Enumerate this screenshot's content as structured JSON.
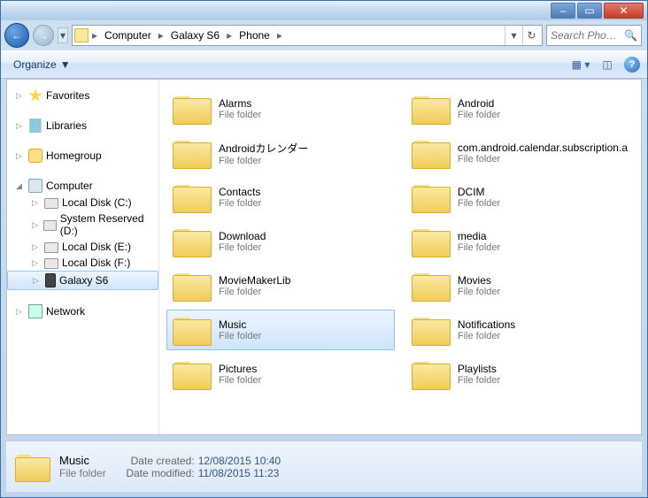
{
  "window_controls": {
    "min": "–",
    "max": "▭",
    "close": "✕"
  },
  "breadcrumb": [
    "Computer",
    "Galaxy S6",
    "Phone"
  ],
  "search_placeholder": "Search Pho…",
  "toolbar": {
    "organize": "Organize"
  },
  "nav": {
    "favorites": "Favorites",
    "libraries": "Libraries",
    "homegroup": "Homegroup",
    "computer": "Computer",
    "drives": [
      "Local Disk (C:)",
      "System Reserved (D:)",
      "Local Disk (E:)",
      "Local Disk (F:)",
      "Galaxy S6"
    ],
    "network": "Network"
  },
  "item_type_label": "File folder",
  "items": [
    {
      "name": "Alarms"
    },
    {
      "name": "Android"
    },
    {
      "name": "Androidカレンダー"
    },
    {
      "name": "com.android.calendar.subscription.a"
    },
    {
      "name": "Contacts"
    },
    {
      "name": "DCIM"
    },
    {
      "name": "Download"
    },
    {
      "name": "media"
    },
    {
      "name": "MovieMakerLib"
    },
    {
      "name": "Movies"
    },
    {
      "name": "Music",
      "selected": true
    },
    {
      "name": "Notifications"
    },
    {
      "name": "Pictures"
    },
    {
      "name": "Playlists"
    }
  ],
  "details": {
    "name": "Music",
    "type": "File folder",
    "created_label": "Date created:",
    "created": "12/08/2015 10:40",
    "modified_label": "Date modified:",
    "modified": "11/08/2015 11:23"
  }
}
